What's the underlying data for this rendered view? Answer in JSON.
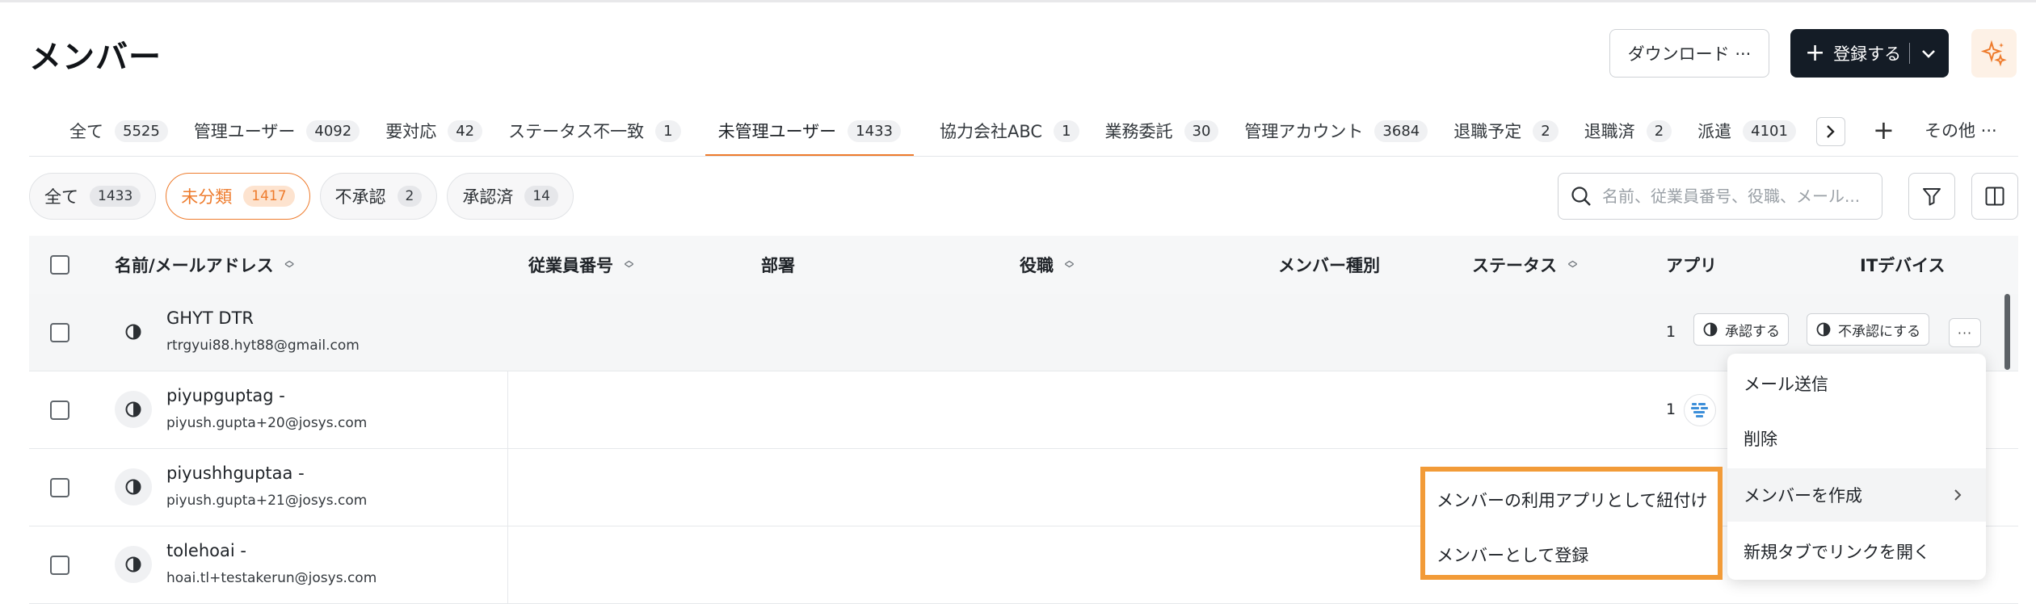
{
  "page": {
    "title": "メンバー"
  },
  "toolbar": {
    "download_label": "ダウンロード ···",
    "register_label": "登録する",
    "ai_icon": "sparkle-icon",
    "accent": "#ee7b2c",
    "dark": "#141c26"
  },
  "tabs": [
    {
      "label": "全て",
      "count": "5525"
    },
    {
      "label": "管理ユーザー",
      "count": "4092"
    },
    {
      "label": "要対応",
      "count": "42"
    },
    {
      "label": "ステータス不一致",
      "count": "1"
    },
    {
      "label": "未管理ユーザー",
      "count": "1433",
      "active": true
    },
    {
      "label": "協力会社ABC",
      "count": "1"
    },
    {
      "label": "業務委託",
      "count": "30"
    },
    {
      "label": "管理アカウント",
      "count": "3684"
    },
    {
      "label": "退職予定",
      "count": "2"
    },
    {
      "label": "退職済",
      "count": "2"
    },
    {
      "label": "派遣",
      "count": "4101"
    }
  ],
  "tab_more_label": "その他 ···",
  "chips": [
    {
      "label": "全て",
      "count": "1433"
    },
    {
      "label": "未分類",
      "count": "1417",
      "active": true
    },
    {
      "label": "不承認",
      "count": "2"
    },
    {
      "label": "承認済",
      "count": "14"
    }
  ],
  "search": {
    "placeholder": "名前、従業員番号、役職、メール..."
  },
  "columns": {
    "name": "名前/メールアドレス",
    "employee_no": "従業員番号",
    "department": "部署",
    "position": "役職",
    "member_type": "メンバー種別",
    "status": "ステータス",
    "apps": "アプリ",
    "it_devices": "ITデバイス"
  },
  "rows": [
    {
      "name": "GHYT DTR",
      "email": "rtrgyui88.hyt88@gmail.com",
      "apps": "1"
    },
    {
      "name": "piyupguptag -",
      "email": "piyush.gupta+20@josys.com",
      "apps": "1"
    },
    {
      "name": "piyushhguptaa -",
      "email": "piyush.gupta+21@josys.com",
      "apps": ""
    },
    {
      "name": "tolehoai -",
      "email": "hoai.tl+testakerun@josys.com",
      "apps": ""
    }
  ],
  "row_actions": {
    "approve": "承認する",
    "disapprove": "不承認にする",
    "more": "···"
  },
  "context_menu": {
    "items": [
      {
        "label": "メール送信"
      },
      {
        "label": "削除"
      },
      {
        "label": "メンバーを作成",
        "has_submenu": true
      },
      {
        "label": "新規タブでリンクを開く"
      }
    ]
  },
  "submenu": {
    "items": [
      {
        "label": "メンバーの利用アプリとして紐付け"
      },
      {
        "label": "メンバーとして登録"
      }
    ],
    "highlight_color": "#f29b38"
  }
}
